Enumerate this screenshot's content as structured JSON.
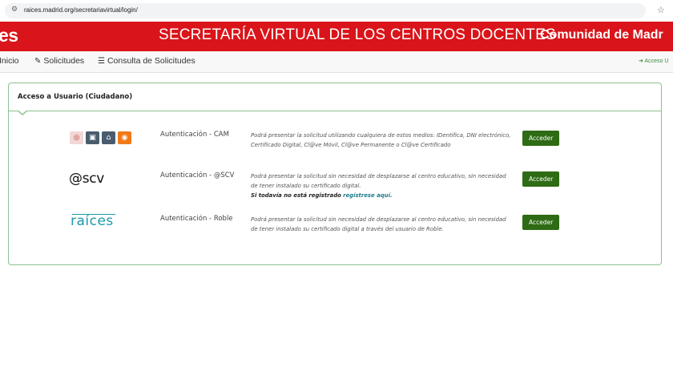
{
  "browser": {
    "url": "raices.madrid.org/secretariavirtual/login/",
    "site_info_icon": "site-settings-icon",
    "bookmark_icon": "star-icon"
  },
  "header": {
    "logo_left": "es",
    "title": "SECRETARÍA VIRTUAL DE LOS CENTROS DOCENTES",
    "logo_right": "Comunidad de Madr",
    "bg_color": "#d9141a"
  },
  "nav": {
    "inicio": "Inicio",
    "solicitudes": "Solicitudes",
    "consulta": "Consulta de Solicitudes",
    "login": "Acceso U",
    "solicitudes_icon": "pencil-icon",
    "consulta_icon": "list-icon",
    "login_icon": "sign-in-icon"
  },
  "panel": {
    "title": "Acceso a Usuario (Ciudadano)",
    "border_color": "#8fc08f"
  },
  "auth_methods": [
    {
      "name": "Autenticación - CAM",
      "description": "Podrá presentar la solicitud utilizando cualquiera de estos medios: IDentifica, DNI electrónico, Certificado Digital, Cl@ve Móvil, Cl@ve Permanente o Cl@ve Certificado",
      "button": "Acceder",
      "icons": [
        "fingerprint-icon",
        "id-card-icon",
        "certificate-icon",
        "clave-icon"
      ]
    },
    {
      "name": "Autenticación - @SCV",
      "logo": "@scv",
      "description": "Podrá presentar la solicitud sin necesidad de desplazarse al centro educativo, sin necesidad de tener instalado su certificado digital.",
      "note": "Si todavía no está registrado",
      "register_link": "regístrese aquí.",
      "button": "Acceder"
    },
    {
      "name": "Autenticación - Roble",
      "logo": "raíces",
      "description": "Podrá presentar la solicitud sin necesidad de desplazarse al centro educativo, sin necesidad de tener instalado su certificado digital a través del usuario de Roble.",
      "button": "Acceder"
    }
  ],
  "colors": {
    "button": "#2e6b14",
    "link": "#1f7a8a",
    "raices": "#1e9aaa"
  }
}
